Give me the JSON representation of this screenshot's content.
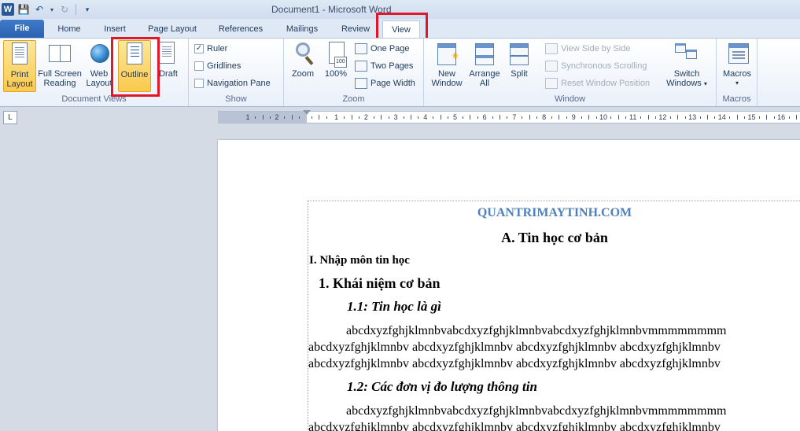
{
  "window": {
    "title": "Document1 - Microsoft Word",
    "app_icon_letter": "W"
  },
  "tabs": [
    "File",
    "Home",
    "Insert",
    "Page Layout",
    "References",
    "Mailings",
    "Review",
    "View"
  ],
  "active_tab": "View",
  "ribbon": {
    "document_views": {
      "label": "Document Views",
      "print_layout": [
        "Print",
        "Layout"
      ],
      "full_screen_reading": [
        "Full Screen",
        "Reading"
      ],
      "web_layout": [
        "Web",
        "Layout"
      ],
      "outline": "Outline",
      "draft": "Draft"
    },
    "show": {
      "label": "Show",
      "ruler": "Ruler",
      "ruler_checked": true,
      "gridlines": "Gridlines",
      "gridlines_checked": false,
      "navigation_pane": "Navigation Pane",
      "navigation_pane_checked": false
    },
    "zoom": {
      "label": "Zoom",
      "zoom": "Zoom",
      "hundred": "100%",
      "hundred_tag": "100",
      "one_page": "One Page",
      "two_pages": "Two Pages",
      "page_width": "Page Width"
    },
    "window": {
      "label": "Window",
      "new_window": [
        "New",
        "Window"
      ],
      "arrange_all": [
        "Arrange",
        "All"
      ],
      "split": "Split",
      "view_side_by_side": "View Side by Side",
      "synchronous_scrolling": "Synchronous Scrolling",
      "reset_window_position": "Reset Window Position",
      "switch_windows": [
        "Switch",
        "Windows"
      ]
    },
    "macros": {
      "label": "Macros",
      "macros": "Macros"
    }
  },
  "ruler": {
    "numbers": [
      "1",
      "2",
      "1",
      "1",
      "2",
      "3",
      "4",
      "5",
      "6",
      "7",
      "8",
      "9",
      "10",
      "11",
      "12",
      "13",
      "14",
      "15",
      "16"
    ],
    "tab_selector": "L"
  },
  "document": {
    "site_title": "QUANTRIMAYTINH.COM",
    "heading_a": "A. Tin học cơ bản",
    "heading_i": "I. Nhập môn tin học",
    "heading_1": "1. Khái niệm cơ bản",
    "heading_1_1": "1.1: Tin học là gì",
    "para1": [
      "abcdxyzfghjklmnbvabcdxyzfghjklmnbvabcdxyzfghjklmnbvmmmmmmmm",
      "abcdxyzfghjklmnbv abcdxyzfghjklmnbv abcdxyzfghjklmnbv abcdxyzfghjklmnbv",
      "abcdxyzfghjklmnbv abcdxyzfghjklmnbv abcdxyzfghjklmnbv abcdxyzfghjklmnbv"
    ],
    "heading_1_2": "1.2: Các đơn vị đo lượng thông tin",
    "para2": [
      "abcdxyzfghjklmnbvabcdxyzfghjklmnbvabcdxyzfghjklmnbvmmmmmmmm",
      "abcdxyzfghjklmnbv abcdxyzfghjklmnbv abcdxyzfghjklmnbv abcdxyzfghjklmnbv"
    ]
  },
  "colors": {
    "highlight": "#e0162b",
    "site_title": "#4f81bd",
    "file_tab": "#2a62b0"
  }
}
